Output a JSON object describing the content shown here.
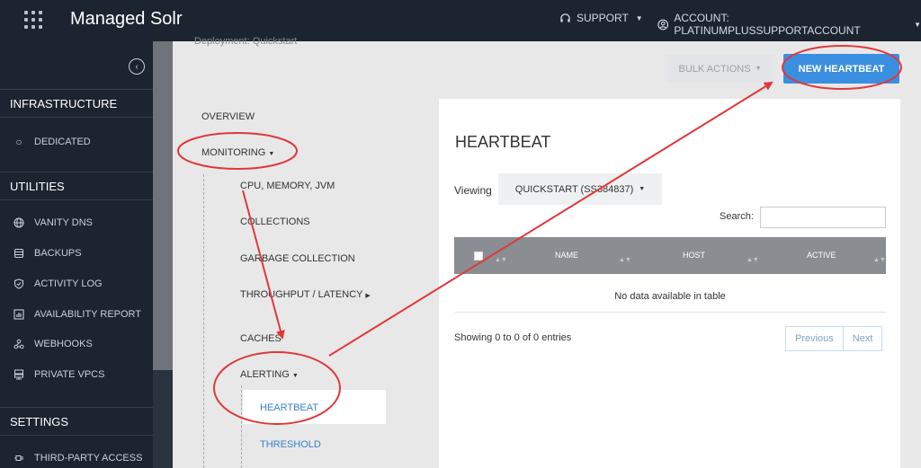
{
  "topbar": {
    "brand": "Managed Solr",
    "support_label": "SUPPORT",
    "account_label": "ACCOUNT: PLATINUMPLUSSUPPORTACCOUNT"
  },
  "sidebar": {
    "sections": [
      {
        "title": "INFRASTRUCTURE",
        "items": [
          {
            "label": "DEDICATED",
            "icon": "circle-icon"
          }
        ]
      },
      {
        "title": "UTILITIES",
        "items": [
          {
            "label": "VANITY DNS",
            "icon": "globe-icon"
          },
          {
            "label": "BACKUPS",
            "icon": "database-icon"
          },
          {
            "label": "ACTIVITY LOG",
            "icon": "shield-icon"
          },
          {
            "label": "AVAILABILITY REPORT",
            "icon": "chart-icon"
          },
          {
            "label": "WEBHOOKS",
            "icon": "webhook-icon"
          },
          {
            "label": "PRIVATE VPCS",
            "icon": "server-icon"
          }
        ]
      },
      {
        "title": "SETTINGS",
        "items": [
          {
            "label": "THIRD-PARTY ACCESS",
            "icon": "plug-icon"
          }
        ]
      }
    ]
  },
  "main": {
    "breadcrumb": "Deployment: Quickstart",
    "bulk_actions_label": "BULK ACTIONS",
    "new_heartbeat_label": "NEW HEARTBEAT",
    "subnav": {
      "overview": "OVERVIEW",
      "monitoring": "MONITORING",
      "cpu": "CPU, MEMORY, JVM",
      "collections": "COLLECTIONS",
      "gc": "GARBAGE COLLECTION",
      "throughput": "THROUGHPUT / LATENCY",
      "caches": "CACHES",
      "alerting": "ALERTING",
      "heartbeat": "HEARTBEAT",
      "threshold": "THRESHOLD"
    },
    "panel": {
      "title": "HEARTBEAT",
      "viewing_label": "Viewing",
      "viewing_value": "QUICKSTART (SS384837)",
      "search_label": "Search:",
      "search_value": "",
      "columns": [
        "NAME",
        "HOST",
        "ACTIVE"
      ],
      "empty_text": "No data available in table",
      "showing_text": "Showing 0 to 0 of 0 entries",
      "prev_label": "Previous",
      "next_label": "Next"
    }
  },
  "colors": {
    "sidebar_bg": "#1c2430",
    "primary_button": "#3b8fe0",
    "annotation": "#e0383b"
  }
}
